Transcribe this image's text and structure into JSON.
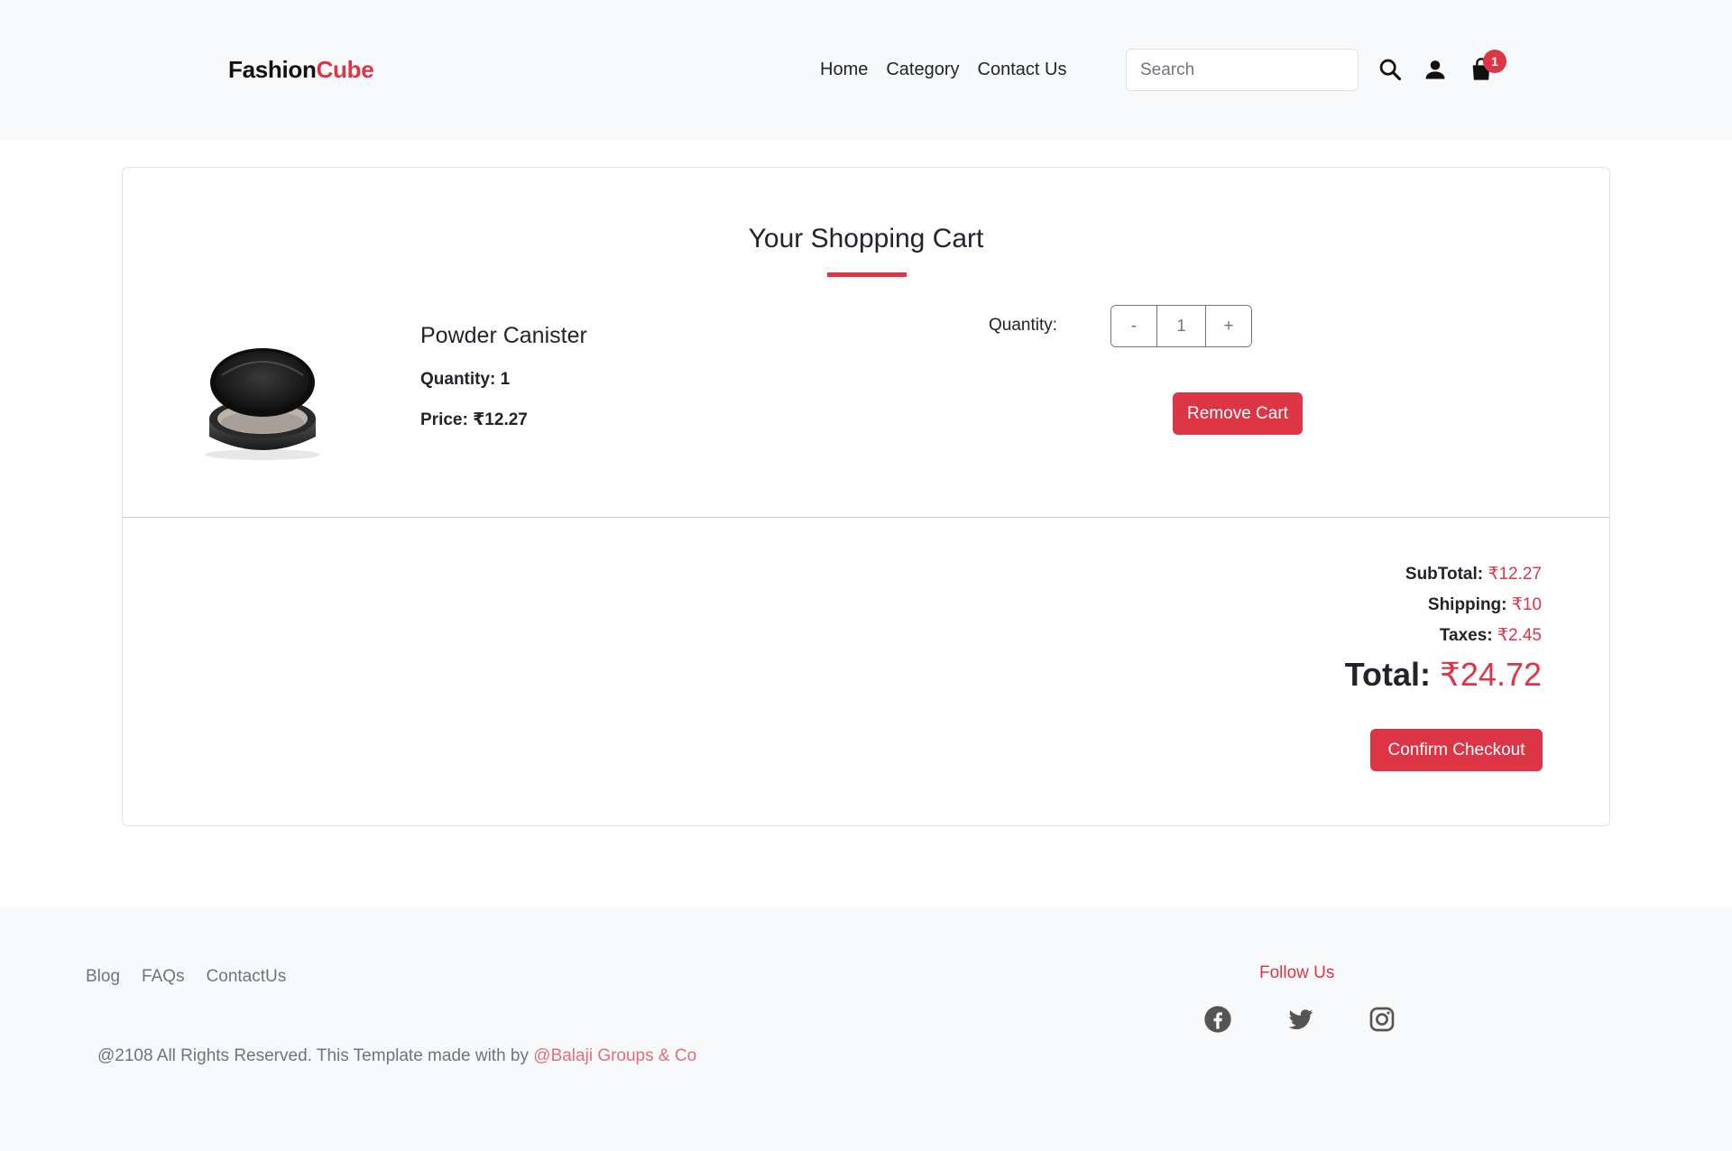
{
  "header": {
    "brand_part1": "Fashion",
    "brand_part2": "Cube",
    "nav": [
      "Home",
      "Category",
      "Contact Us"
    ],
    "search_placeholder": "Search",
    "cart_count": "1",
    "icons": [
      "search-icon",
      "user-icon",
      "shopping-bag-icon"
    ]
  },
  "cart": {
    "title": "Your Shopping Cart",
    "item": {
      "name": "Powder Canister",
      "quantity_text": "Quantity: 1",
      "price_text": "Price: ₹12.27",
      "quantity_label": "Quantity:",
      "quantity_value": "1",
      "decrement_label": "-",
      "increment_label": "+",
      "remove_label": "Remove Cart"
    },
    "summary": {
      "subtotal_label": "SubTotal: ",
      "subtotal_value": "₹12.27",
      "shipping_label": "Shipping: ",
      "shipping_value": "₹10",
      "taxes_label": "Taxes: ",
      "taxes_value": "₹2.45",
      "total_label": "Total: ",
      "total_value": "₹24.72",
      "checkout_label": "Confirm Checkout"
    }
  },
  "footer": {
    "links": [
      "Blog",
      "FAQs",
      "ContactUs"
    ],
    "copyright": "@2108 All Rights Reserved. This Template made with by ",
    "credit": "@Balaji Groups & Co",
    "follow_title": "Follow Us",
    "social_icons": [
      "facebook-icon",
      "twitter-icon",
      "instagram-icon"
    ]
  },
  "colors": {
    "accent": "#dc3545",
    "background_light": "#f8f9fa",
    "text": "#212529",
    "muted": "#6c757d"
  }
}
